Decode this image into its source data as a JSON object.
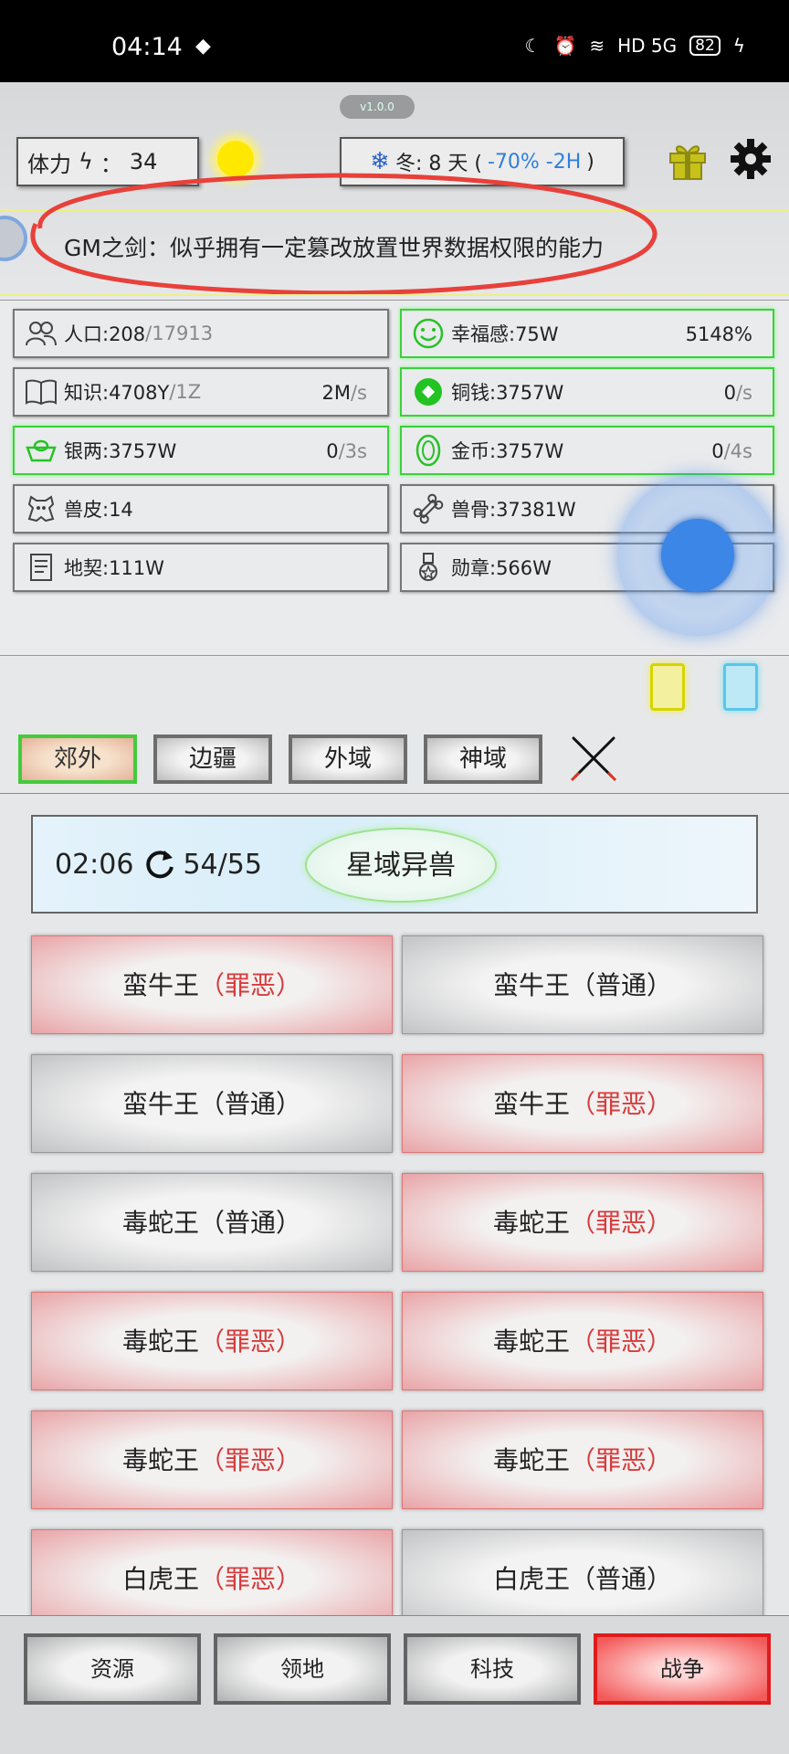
{
  "status_bar": {
    "time": "04:14",
    "network": "HD 5G",
    "battery": "82"
  },
  "header": {
    "version": "v1.0.0",
    "stamina_label": "体力",
    "stamina_sep": "：",
    "stamina_value": "34",
    "season_prefix": "冬: 8 天 (",
    "season_effect": "-70% -2H",
    "season_suffix": ")"
  },
  "marquee": {
    "text": "GM之剑：似乎拥有一定篡改放置世界数据权限的能力"
  },
  "resources": [
    {
      "label": "人口:208",
      "extra": "/17913",
      "rate": "",
      "rate_unit": ""
    },
    {
      "label": "幸福感:75W",
      "extra": "",
      "rate": "5148%",
      "rate_unit": ""
    },
    {
      "label": "知识:4708Y",
      "extra": "/1Z",
      "rate": "2M",
      "rate_unit": "/s"
    },
    {
      "label": "铜钱:3757W",
      "extra": "",
      "rate": "0",
      "rate_unit": "/s"
    },
    {
      "label": "银两:3757W",
      "extra": "",
      "rate": "0",
      "rate_unit": "/3s"
    },
    {
      "label": "金币:3757W",
      "extra": "",
      "rate": "0",
      "rate_unit": "/4s"
    },
    {
      "label": "兽皮:14",
      "extra": "",
      "rate": "",
      "rate_unit": ""
    },
    {
      "label": "兽骨:37381W",
      "extra": "",
      "rate": "",
      "rate_unit": ""
    },
    {
      "label": "地契:111W",
      "extra": "",
      "rate": "",
      "rate_unit": ""
    },
    {
      "label": "勋章:566W",
      "extra": "",
      "rate": "",
      "rate_unit": ""
    }
  ],
  "tabs": [
    "郊外",
    "边疆",
    "外域",
    "神域"
  ],
  "battle": {
    "timer": "02:06",
    "progress": "54/55",
    "zone": "星域异兽",
    "enemies": [
      {
        "name": "蛮牛王",
        "tag": "（罪恶）",
        "type": "evil"
      },
      {
        "name": "蛮牛王",
        "tag": "（普通）",
        "type": "normal"
      },
      {
        "name": "蛮牛王",
        "tag": "（普通）",
        "type": "normal"
      },
      {
        "name": "蛮牛王",
        "tag": "（罪恶）",
        "type": "evil"
      },
      {
        "name": "毒蛇王",
        "tag": "（普通）",
        "type": "normal"
      },
      {
        "name": "毒蛇王",
        "tag": "（罪恶）",
        "type": "evil"
      },
      {
        "name": "毒蛇王",
        "tag": "（罪恶）",
        "type": "evil"
      },
      {
        "name": "毒蛇王",
        "tag": "（罪恶）",
        "type": "evil"
      },
      {
        "name": "毒蛇王",
        "tag": "（罪恶）",
        "type": "evil"
      },
      {
        "name": "毒蛇王",
        "tag": "（罪恶）",
        "type": "evil"
      },
      {
        "name": "白虎王",
        "tag": "（罪恶）",
        "type": "evil"
      },
      {
        "name": "白虎王",
        "tag": "（普通）",
        "type": "normal"
      }
    ]
  },
  "bottom_nav": [
    "资源",
    "领地",
    "科技",
    "战争"
  ]
}
